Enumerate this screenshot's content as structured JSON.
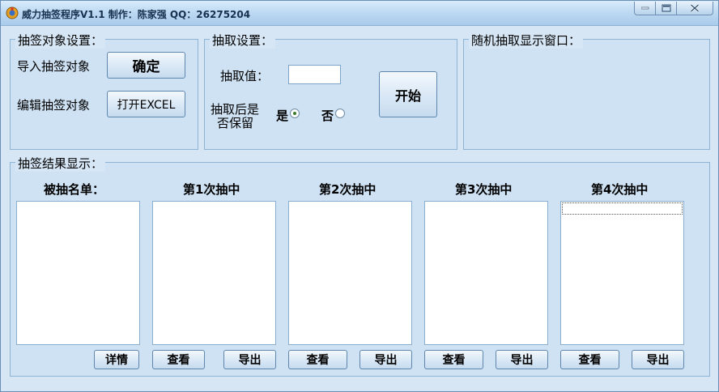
{
  "window": {
    "title": "威力抽签程序V1.1  制作：陈家强  QQ：26275204"
  },
  "setup_group": {
    "title": "抽签对象设置：",
    "import_label": "导入抽签对象",
    "confirm_button": "确定",
    "edit_label": "编辑抽签对象",
    "open_excel_button": "打开EXCEL"
  },
  "draw_settings": {
    "title": "抽取设置：",
    "value_label": "抽取值：",
    "value_input": "",
    "keep_label_line1": "抽取后是",
    "keep_label_line2": "否保留",
    "yes_label": "是",
    "no_label": "否",
    "selected": "yes",
    "start_button": "开始"
  },
  "display_group": {
    "title": "随机抽取显示窗口："
  },
  "results_group": {
    "title": "抽签结果显示：",
    "columns": [
      {
        "header": "被抽名单：",
        "buttons": [
          "详情"
        ]
      },
      {
        "header": "第1次抽中",
        "buttons": [
          "查看",
          "导出"
        ]
      },
      {
        "header": "第2次抽中",
        "buttons": [
          "查看",
          "导出"
        ]
      },
      {
        "header": "第3次抽中",
        "buttons": [
          "查看",
          "导出"
        ]
      },
      {
        "header": "第4次抽中",
        "buttons": [
          "查看",
          "导出"
        ]
      }
    ]
  }
}
